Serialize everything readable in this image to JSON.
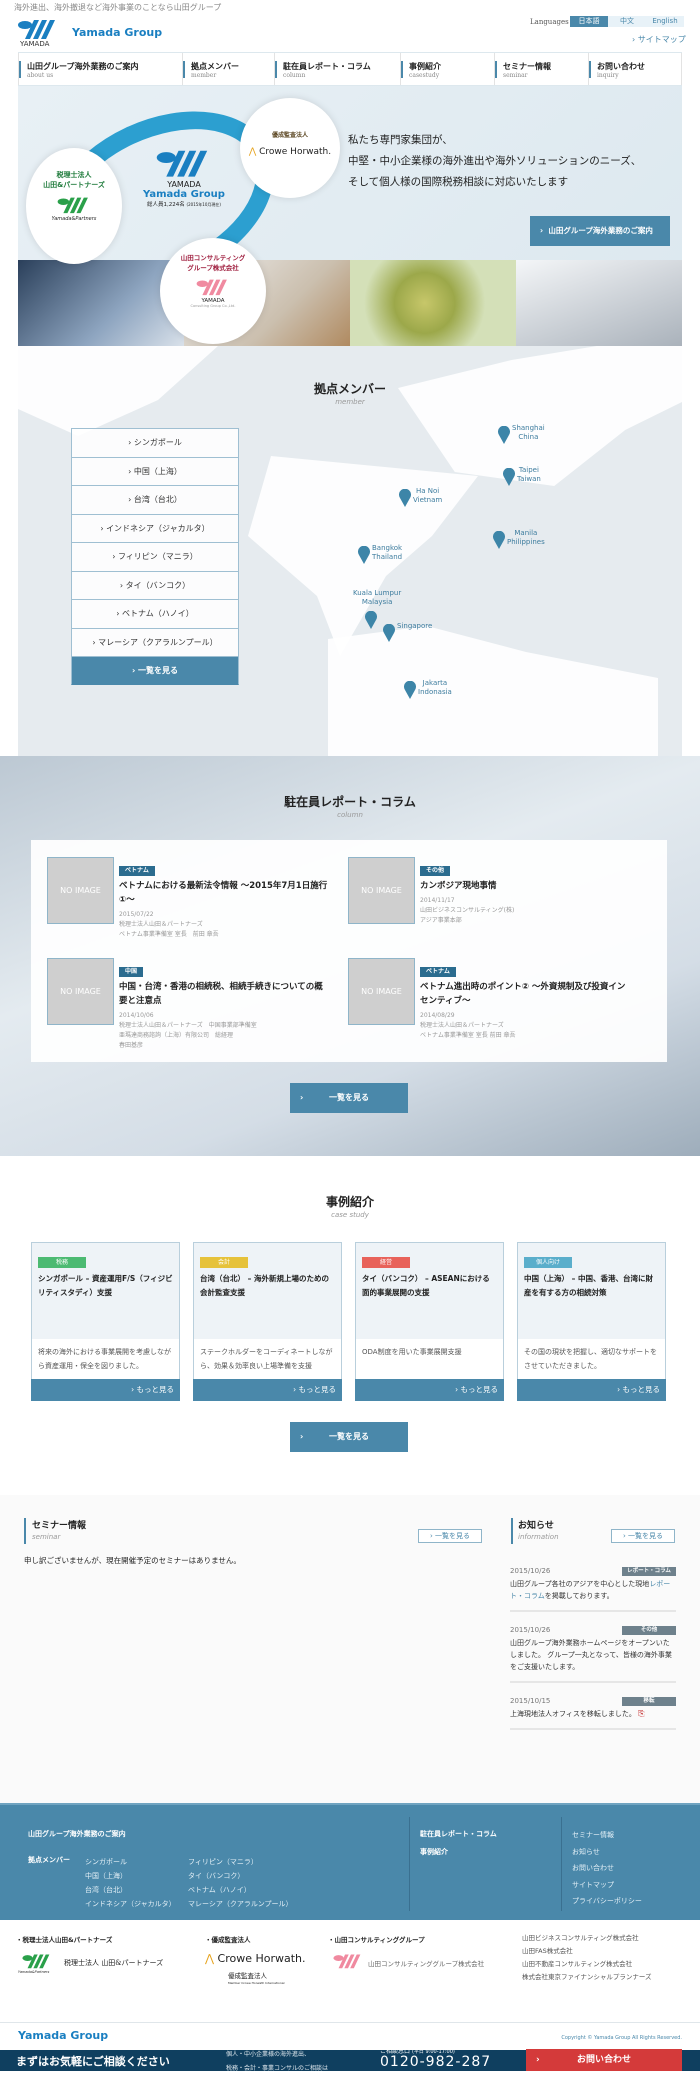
{
  "header": {
    "tagline": "海外進出、海外撤退など海外事業のことなら山田グループ",
    "logo_text": "YAMADA",
    "brand": "Yamada Group",
    "languages_label": "Languages",
    "languages": [
      "日本語",
      "中文",
      "English"
    ],
    "active_language": "日本語",
    "sitemap": "サイトマップ"
  },
  "nav": [
    {
      "label": "山田グループ海外業務のご案内",
      "sub": "about us"
    },
    {
      "label": "拠点メンバー",
      "sub": "member"
    },
    {
      "label": "駐在員レポート・コラム",
      "sub": "column"
    },
    {
      "label": "事例紹介",
      "sub": "casestudy"
    },
    {
      "label": "セミナー情報",
      "sub": "seminar"
    },
    {
      "label": "お問い合わせ",
      "sub": "inquiry"
    }
  ],
  "hero": {
    "partners_name": "税理士法人\n山田&パートナーズ",
    "partners_logo": "Yamada&Partners",
    "center_logo": "YAMADA",
    "center_brand": "Yamada Group",
    "employees": "総人員1,224名",
    "employees_note": "(2015年10月現在)",
    "crowe_label": "優成監査法人",
    "crowe_logo": "Crowe Horwath.",
    "consulting_name": "山田コンサルティング\nグループ株式会社",
    "consulting_logo": "YAMADA",
    "consulting_sub": "Consulting Group Co.,Ltd.",
    "copy": [
      "私たち専門家集団が、",
      "中堅・中小企業様の海外進出や海外ソリューションのニーズ、",
      "そして個人様の国際税務相談に対応いたします"
    ],
    "button": "山田グループ海外業務のご案内"
  },
  "member": {
    "title": "拠点メンバー",
    "subtitle": "member",
    "list": [
      "シンガポール",
      "中国（上海）",
      "台湾（台北）",
      "インドネシア（ジャカルタ）",
      "フィリピン（マニラ）",
      "タイ（バンコク）",
      "ベトナム（ハノイ）",
      "マレーシア（クアラルンプール）"
    ],
    "view_all": "一覧を見る",
    "pins": [
      {
        "city": "Shanghai",
        "country": "China"
      },
      {
        "city": "Taipei",
        "country": "Taiwan"
      },
      {
        "city": "Ha Noi",
        "country": "Vietnam"
      },
      {
        "city": "Bangkok",
        "country": "Thailand"
      },
      {
        "city": "Manila",
        "country": "Philippines"
      },
      {
        "city": "Kuala Lumpur",
        "country": "Malaysia"
      },
      {
        "city": "Singapore",
        "country": ""
      },
      {
        "city": "Jakarta",
        "country": "Indonasia"
      }
    ]
  },
  "column": {
    "title": "駐在員レポート・コラム",
    "subtitle": "column",
    "no_image": "NO IMAGE",
    "items": [
      {
        "tag": "ベトナム",
        "title": "ベトナムにおける最新法令情報 ～2015年7月1日施行①～",
        "date": "2015/07/22",
        "meta": [
          "税理士法人山田＆パートナーズ",
          "ベトナム事業準備室 室長　前田 章吾"
        ]
      },
      {
        "tag": "その他",
        "title": "カンボジア現地事情",
        "date": "2014/11/17",
        "meta": [
          "山田ビジネスコンサルティング(株)",
          "アジア事業本部"
        ]
      },
      {
        "tag": "中国",
        "title": "中国・台湾・香港の相続税、相続手続きについての概要と注意点",
        "date": "2014/10/06",
        "meta": [
          "税理士法人山田＆パートナーズ　中国事業部準備室",
          "亜瑪達商務諮詢（上海）有限公司　総経理",
          "春田基彦"
        ]
      },
      {
        "tag": "ベトナム",
        "title": "ベトナム進出時のポイント② ～外資規制及び投資インセンティブ～",
        "date": "2014/08/29",
        "meta": [
          "税理士法人山田＆パートナーズ",
          "ベトナム事業準備室 室長 前田 章吾"
        ]
      }
    ],
    "view_all": "一覧を見る"
  },
  "cases": {
    "title": "事例紹介",
    "subtitle": "case study",
    "items": [
      {
        "label": "税務",
        "color": "#4cba72",
        "title": "シンガポール – 資産運用F/S（フィジビリティスタディ）支援",
        "desc": "将来の海外における事業展開を考慮しながら資産運用・保全を図りました。"
      },
      {
        "label": "会計",
        "color": "#e6c23a",
        "title": "台湾（台北） – 海外新規上場のための会計監査支援",
        "desc": "ステークホルダーをコーディネートしながら、効果＆効率良い上場準備を支援"
      },
      {
        "label": "経営",
        "color": "#e8625a",
        "title": "タイ（バンコク） – ASEANにおける面的事業展開の支援",
        "desc": "ODA制度を用いた事業展開支援"
      },
      {
        "label": "個人向け",
        "color": "#5aaecb",
        "title": "中国（上海） – 中国、香港、台湾に財産を有する方の相続対策",
        "desc": "その国の現状を把握し、適切なサポートをさせていただきました。"
      }
    ],
    "more": "もっと見る",
    "view_all": "一覧を見る"
  },
  "seminar": {
    "title": "セミナー情報",
    "subtitle": "seminar",
    "view_all": "一覧を見る",
    "empty": "申し訳ございませんが、現在開催予定のセミナーはありません。"
  },
  "news": {
    "title": "お知らせ",
    "subtitle": "information",
    "view_all": "一覧を見る",
    "items": [
      {
        "date": "2015/10/26",
        "tag": "レポート・コラム",
        "text": "山田グループ各社のアジアを中心とした現地",
        "link": "レポート・コラム",
        "text_after": "を掲載しております。"
      },
      {
        "date": "2015/10/26",
        "tag": "その他",
        "text": "山田グループ海外業務ホームページをオープンいたしました。 グループ一丸となって、皆様の海外事業をご支援いたします。"
      },
      {
        "date": "2015/10/15",
        "tag": "移転",
        "text": "上海現地法人オフィスを移転しました。",
        "icon": "pdf-icon"
      }
    ]
  },
  "footer": {
    "about": "山田グループ海外業務のご案内",
    "member_label": "拠点メンバー",
    "members_col1": [
      "シンガポール",
      "中国（上海）",
      "台湾（台北）",
      "インドネシア（ジャカルタ）"
    ],
    "members_col2": [
      "フィリピン（マニラ）",
      "タイ（バンコク）",
      "ベトナム（ハノイ）",
      "マレーシア（クアラルンプール）"
    ],
    "column": "駐在員レポート・コラム",
    "cases": "事例紹介",
    "links": [
      "セミナー情報",
      "お知らせ",
      "お問い合わせ",
      "サイトマップ",
      "プライバシーポリシー"
    ]
  },
  "partners": {
    "p1_head": "・税理士法人山田&パートナーズ",
    "p1_logo": "税理士法人 山田&パートナーズ",
    "p1_sub": "Yamada&Partners",
    "p2_head": "・優成監査法人",
    "p2_logo": "Crowe Horwath.",
    "p2_sub": "優成監査法人",
    "p2_note": "Member Crowe Horwath International",
    "p3_head": "・山田コンサルティンググループ",
    "p3_logo": "山田コンサルティンググループ株式会社",
    "companies": [
      "山田ビジネスコンサルティング株式会社",
      "山田FAS株式会社",
      "山田不動産コンサルティング株式会社",
      "株式会社東京ファイナンシャルプランナーズ"
    ]
  },
  "bottom": {
    "brand": "Yamada Group",
    "copyright": "Copyright © Yamada Group All Rights Reserved."
  },
  "cta": {
    "headline": "まずはお気軽にご相談ください",
    "line1": "個人・中小企業様の海外進出、",
    "line2": "税務・会計・事業コンサルのご相談は",
    "window": "ご相談窓口",
    "hours": "(平日 9:00-17:00)",
    "phone": "0120-982-287",
    "button": "お問い合わせ"
  },
  "colors": {
    "primary": "#4a88aa",
    "navy": "#0f3f5f",
    "cta_red": "#d43a3a",
    "brand_blue": "#1a7fc1"
  }
}
